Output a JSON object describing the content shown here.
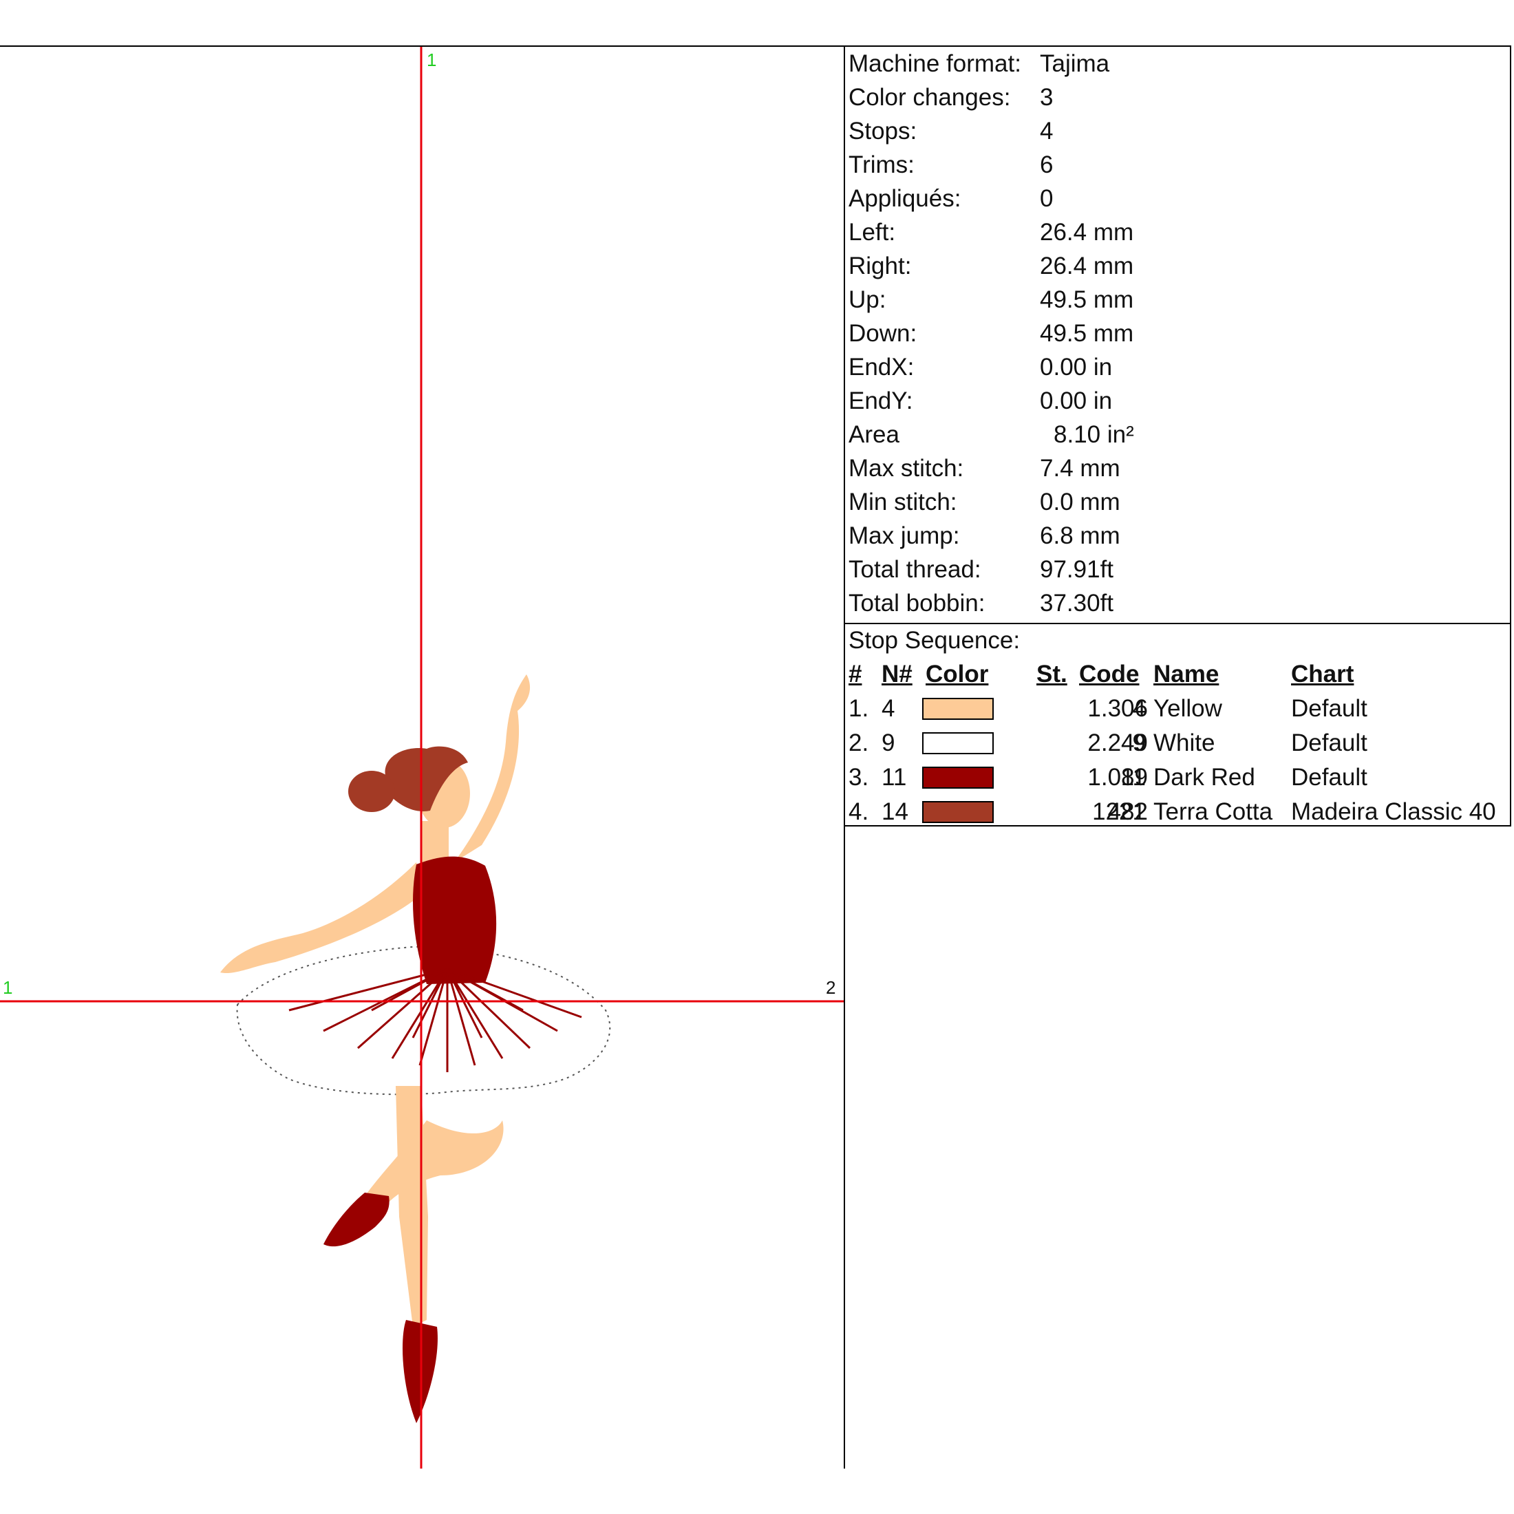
{
  "summary": [
    {
      "label": "Machine format:",
      "value": "Tajima"
    },
    {
      "label": "Color changes:",
      "value": "3"
    },
    {
      "label": "Stops:",
      "value": "4"
    },
    {
      "label": "Trims:",
      "value": "6"
    },
    {
      "label": "Appliqués:",
      "value": "0"
    },
    {
      "label": "Left:",
      "value": "26.4 mm"
    },
    {
      "label": "Right:",
      "value": "26.4 mm"
    },
    {
      "label": "Up:",
      "value": "49.5 mm"
    },
    {
      "label": "Down:",
      "value": "49.5 mm"
    },
    {
      "label": "EndX:",
      "value": "0.00 in"
    },
    {
      "label": "EndY:",
      "value": "0.00 in"
    },
    {
      "label": "Area",
      "value": "8.10 in²"
    },
    {
      "label": "Max stitch:",
      "value": "7.4 mm"
    },
    {
      "label": "Min stitch:",
      "value": "0.0 mm"
    },
    {
      "label": "Max jump:",
      "value": "6.8 mm"
    },
    {
      "label": "Total thread:",
      "value": "97.91ft"
    },
    {
      "label": "Total bobbin:",
      "value": "37.30ft"
    }
  ],
  "stop_sequence": {
    "title": "Stop Sequence:",
    "headers": {
      "num": "#",
      "n": "N#",
      "color": "Color",
      "st": "St.",
      "code": "Code",
      "name": "Name",
      "chart": "Chart"
    },
    "rows": [
      {
        "num": "1.",
        "n": "4",
        "color": "#fdcb97",
        "st": "1.306",
        "code": "4",
        "name": "Yellow",
        "chart": "Default"
      },
      {
        "num": "2.",
        "n": "9",
        "color": "#ffffff",
        "st": "2.249",
        "code": "9",
        "name": "White",
        "chart": "Default"
      },
      {
        "num": "3.",
        "n": "11",
        "color": "#990000",
        "st": "1.089",
        "code": "11",
        "name": "Dark Red",
        "chart": "Default"
      },
      {
        "num": "4.",
        "n": "14",
        "color": "#a33a25",
        "st": "482",
        "code": "1221",
        "name": "Terra Cotta",
        "chart": "Madeira Classic 40"
      }
    ]
  },
  "axes": {
    "vertical_top_label": "1",
    "horizontal_left_label": "1",
    "horizontal_right_label": "2",
    "line_color": "#e8000b",
    "label_color": "#22cc22"
  },
  "design": {
    "skin_color": "#fdcb97",
    "dress_color": "#990000",
    "hair_color": "#a33a25",
    "tutu_outline_color": "#555555"
  }
}
